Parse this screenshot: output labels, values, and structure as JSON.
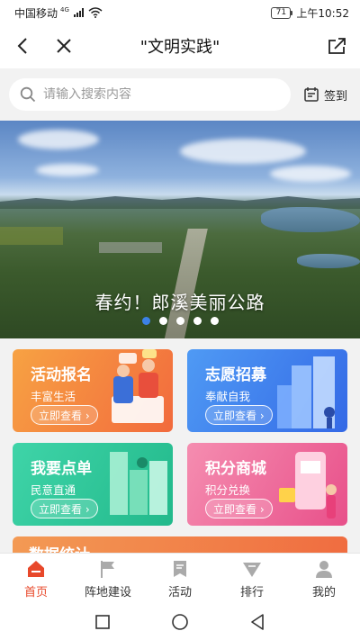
{
  "status_bar": {
    "carrier": "中国移动",
    "network": "4G",
    "battery": "71",
    "time": "上午10:52"
  },
  "nav": {
    "title": "\"文明实践\"",
    "back_icon": "back-arrow-icon",
    "close_icon": "close-icon",
    "share_icon": "share-icon"
  },
  "search": {
    "placeholder": "请输入搜索内容",
    "signin_label": "签到"
  },
  "banner": {
    "caption": "春约！郎溪美丽公路",
    "slide_count": 5,
    "active_slide": 1
  },
  "cards": [
    {
      "title": "活动报名",
      "subtitle": "丰富生活",
      "button": "立即查看 ›",
      "color": "#f4833f"
    },
    {
      "title": "志愿招募",
      "subtitle": "奉献自我",
      "button": "立即查看 ›",
      "color": "#3f7cec"
    },
    {
      "title": "我要点单",
      "subtitle": "民意直通",
      "button": "立即查看 ›",
      "color": "#2cc498"
    },
    {
      "title": "积分商城",
      "subtitle": "积分兑换",
      "button": "立即查看 ›",
      "color": "#ee6a98"
    }
  ],
  "stats_card": {
    "title": "数据统计"
  },
  "tabs": [
    {
      "label": "首页",
      "icon": "home-icon",
      "active": true
    },
    {
      "label": "阵地建设",
      "icon": "flag-icon",
      "active": false
    },
    {
      "label": "活动",
      "icon": "activity-icon",
      "active": false
    },
    {
      "label": "排行",
      "icon": "ranking-icon",
      "active": false
    },
    {
      "label": "我的",
      "icon": "profile-icon",
      "active": false
    }
  ],
  "colors": {
    "accent_active": "#e8482a",
    "dot_active": "#3c82e8"
  }
}
